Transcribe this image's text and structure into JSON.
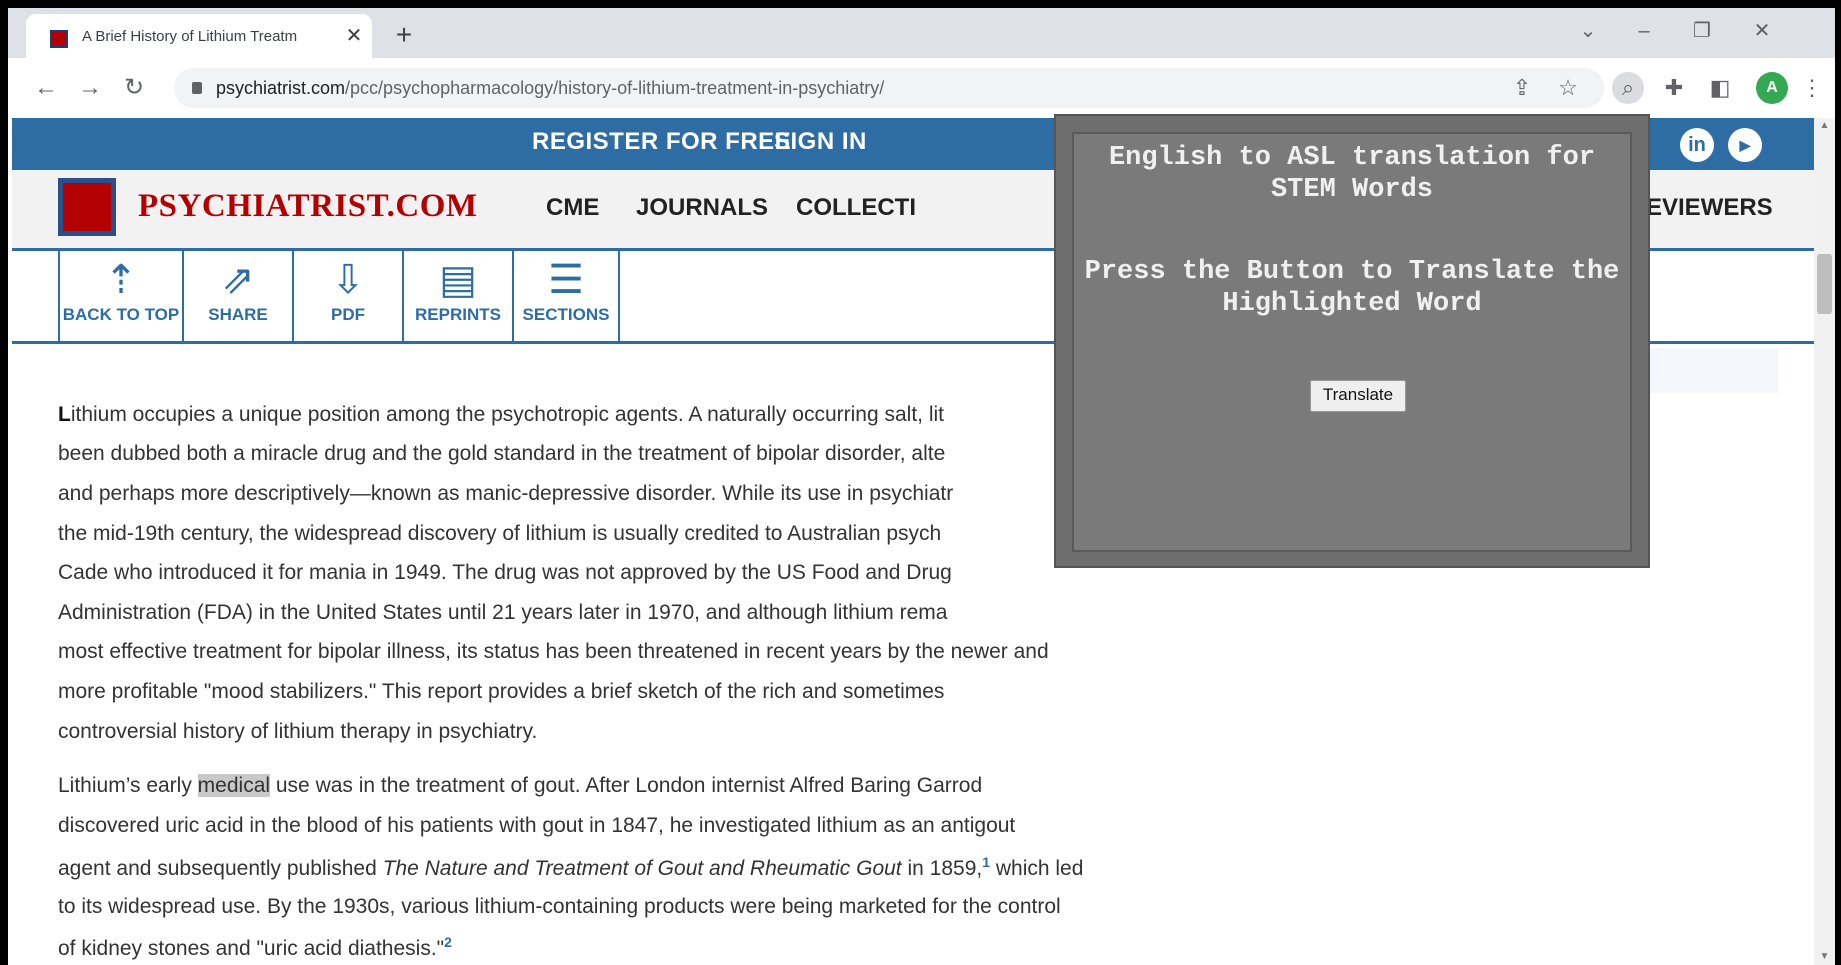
{
  "browser": {
    "tab_title": "A Brief History of Lithium Treatm",
    "url_domain": "psychiatrist.com",
    "url_path": "/pcc/psychopharmacology/history-of-lithium-treatment-in-psychiatry/",
    "profile_initial": "A"
  },
  "site": {
    "topbar": {
      "register": "REGISTER FOR FREE",
      "signin": "SIGN IN"
    },
    "logo_text": "PSYCHIATRIST.COM",
    "nav": {
      "cme": "CME",
      "journals": "JOURNALS",
      "collections": "COLLECTI",
      "reviewers": "EVIEWERS"
    },
    "social": {
      "linkedin": "in",
      "youtube": "▶"
    }
  },
  "actions": [
    {
      "label": "BACK TO TOP",
      "icon": "arrow-up-icon"
    },
    {
      "label": "SHARE",
      "icon": "share-icon"
    },
    {
      "label": "PDF",
      "icon": "pdf-download-icon"
    },
    {
      "label": "REPRINTS",
      "icon": "reprints-icon"
    },
    {
      "label": "SECTIONS",
      "icon": "sections-icon"
    }
  ],
  "article": {
    "p1": [
      "ithium occupies a unique position among the psychotropic agents. A naturally occurring salt, lit",
      "been dubbed both a miracle drug and the gold standard in the treatment of bipolar disorder, alte",
      "and perhaps more descriptively—known as manic-depressive disorder. While its use in psychiatr",
      "the mid-19th century, the widespread discovery of lithium is usually credited to Australian psych",
      "Cade who introduced it for mania in 1949. The drug was not approved by the US Food and Drug",
      "Administration (FDA) in the United States until 21 years later in 1970, and although lithium rema",
      "most effective treatment for bipolar illness, its status has been threatened in recent years by the newer and",
      "more profitable \"mood stabilizers.\" This report provides a brief sketch of the rich and sometimes",
      "controversial history of lithium therapy in psychiatry."
    ],
    "p1_dropcap": "L",
    "p2": {
      "l1_pre": "Lithium’s early ",
      "l1_hl": "medical",
      "l1_post": " use was in the treatment of gout. After London internist Alfred Baring Garrod",
      "l2": "discovered uric acid in the blood of his patients with gout in 1847, he investigated lithium as an antigout",
      "l3_pre": "agent and subsequently published ",
      "l3_ital": "The Nature and Treatment of Gout and Rheumatic Gout",
      "l3_post": " in 1859,",
      "l3_sup": "1",
      "l3_end": " which led",
      "l4": "to its widespread use. By the 1930s, various lithium-containing products were being marketed for the control",
      "l5": "of kidney stones and \"uric acid diathesis.\"",
      "l5_sup": "2"
    }
  },
  "popup": {
    "title": "English to ASL translation for STEM Words",
    "subtitle": "Press the Button to Translate the Highlighted Word",
    "button": "Translate"
  }
}
